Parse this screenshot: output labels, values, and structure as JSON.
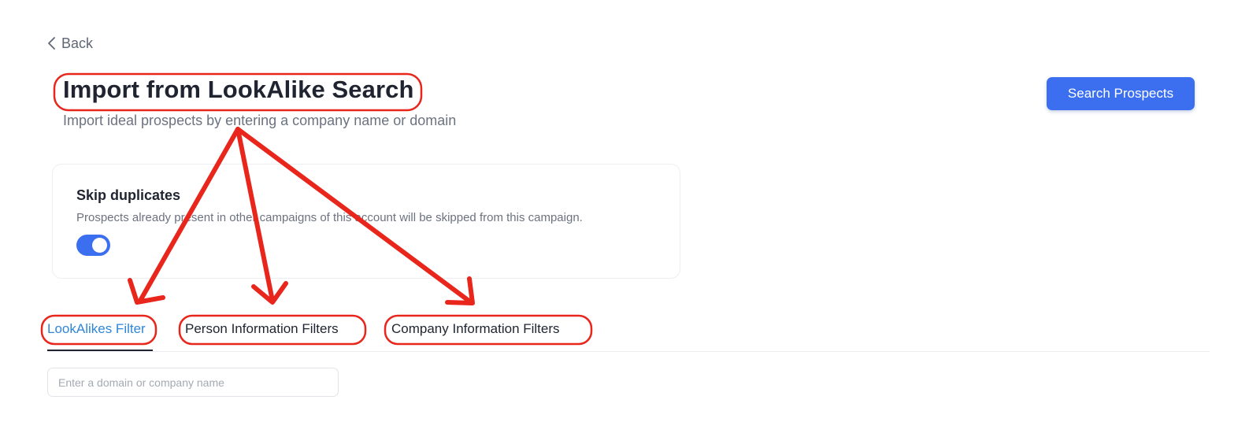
{
  "back": {
    "label": "Back"
  },
  "header": {
    "title": "Import from LookAlike Search",
    "subtitle": "Import ideal prospects by entering a company name or domain",
    "search_button_label": "Search Prospects"
  },
  "skip_duplicates": {
    "title": "Skip duplicates",
    "description": "Prospects already present in other campaigns of this account will be skipped from this campaign.",
    "enabled": true
  },
  "tabs": [
    {
      "label": "LookAlikes Filter",
      "active": true
    },
    {
      "label": "Person Information Filters",
      "active": false
    },
    {
      "label": "Company Information Filters",
      "active": false
    }
  ],
  "search_input": {
    "value": "",
    "placeholder": "Enter a domain or company name"
  },
  "colors": {
    "primary": "#3b6ff0",
    "active_tab": "#2f86d6",
    "annotation": "#e8261c"
  },
  "icons": {
    "back": "chevron-left-icon"
  }
}
